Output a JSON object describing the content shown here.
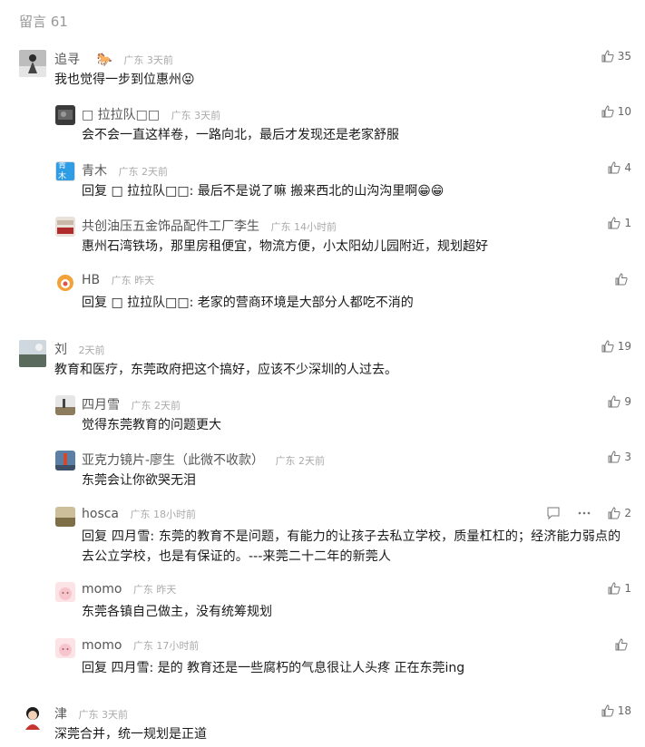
{
  "header": {
    "title": "留言 61"
  },
  "comments": [
    {
      "name": "追寻",
      "region": "广东",
      "time": "3天前",
      "text": "我也觉得一步到位惠州😝",
      "likes": "35",
      "replies": [
        {
          "name": "□ 拉拉队□□",
          "region": "广东",
          "time": "3天前",
          "text": "会不会一直这样卷，一路向北，最后才发现还是老家舒服",
          "likes": "10"
        },
        {
          "name": "青木",
          "region": "广东",
          "time": "2天前",
          "text": "回复 □ 拉拉队□□: 最后不是说了嘛 搬来西北的山沟沟里啊😁😁",
          "likes": "4",
          "avatar_text": "青木"
        },
        {
          "name": "共创油压五金饰品配件工厂李生",
          "region": "广东",
          "time": "14小时前",
          "text": "惠州石湾铁场，那里房租便宜，物流方便，小太阳幼儿园附近，规划超好",
          "likes": "1"
        },
        {
          "name": "HB",
          "region": "广东",
          "time": "昨天",
          "text": "回复 □ 拉拉队□□: 老家的营商环境是大部分人都吃不消的",
          "likes": ""
        }
      ]
    },
    {
      "name": "刘",
      "region": "",
      "time": "2天前",
      "text": "教育和医疗，东莞政府把这个搞好，应该不少深圳的人过去。",
      "likes": "19",
      "replies": [
        {
          "name": "四月雪",
          "region": "广东",
          "time": "2天前",
          "text": "觉得东莞教育的问题更大",
          "likes": "9"
        },
        {
          "name": "亚克力镜片-廖生（此微不收款）",
          "region": "广东",
          "time": "2天前",
          "text": "东莞会让你欲哭无泪",
          "likes": "3"
        },
        {
          "name": "hosca",
          "region": "广东",
          "time": "18小时前",
          "text": "回复 四月雪: 东莞的教育不是问题，有能力的让孩子去私立学校，质量杠杠的；经济能力弱点的去公立学校，也是有保证的。---来莞二十二年的新莞人",
          "likes": "2",
          "show_actions": true
        },
        {
          "name": "momo",
          "region": "广东",
          "time": "昨天",
          "text": "东莞各镇自己做主，没有统筹规划",
          "likes": "1"
        },
        {
          "name": "momo",
          "region": "广东",
          "time": "17小时前",
          "text": "回复 四月雪: 是的  教育还是一些腐朽的气息很让人头疼  正在东莞ing",
          "likes": ""
        }
      ]
    },
    {
      "name": "津",
      "region": "广东",
      "time": "3天前",
      "text": "深莞合并，统一规划是正道",
      "likes": "18",
      "replies": []
    }
  ],
  "colors": {
    "link": "#576b95",
    "meta": "#aaaaaa",
    "badge": "#2f9de4"
  },
  "icons": [
    "thumbs-up-icon",
    "reply-icon",
    "more-icon",
    "horse-badge-icon"
  ]
}
